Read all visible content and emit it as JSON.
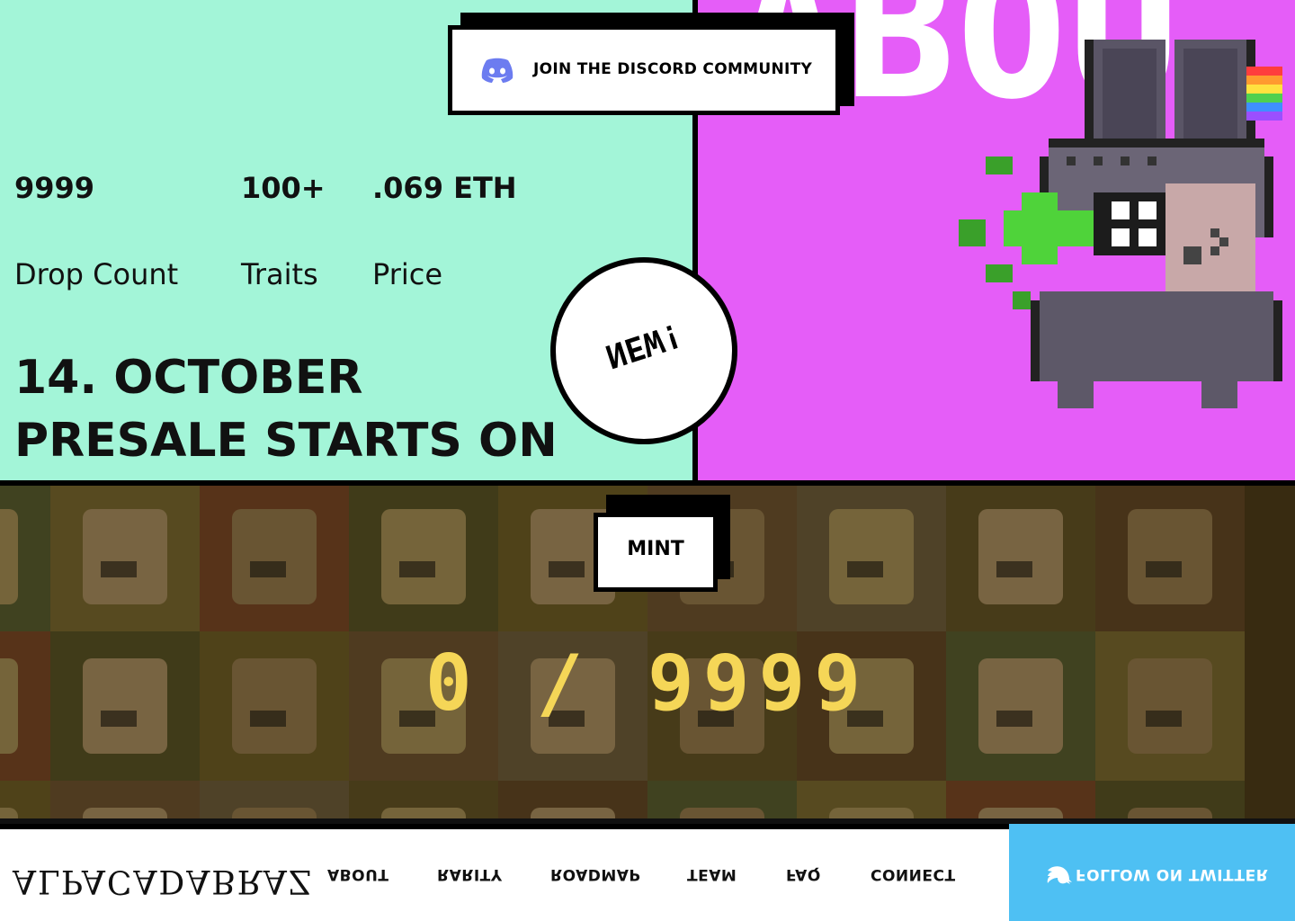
{
  "nav": {
    "logo": "ALPACADABRAZ",
    "links": [
      "ABOUT",
      "RARITY",
      "ROADMAP",
      "TEAM",
      "FAQ",
      "CONNECT"
    ],
    "twitter_label": "FOLLOW ON TWITTER"
  },
  "mint": {
    "counter": "0 / 9999",
    "button_label": "MINT"
  },
  "hero": {
    "headline_line1": "PRESALE STARTS ON",
    "headline_line2": "14. OCTOBER",
    "stats": [
      {
        "label": "Drop Count",
        "value": "9999"
      },
      {
        "label": "Traits",
        "value": "100+"
      },
      {
        "label": "Price",
        "value": ".069 ETH"
      }
    ],
    "badge": "NEW!",
    "discord_label": "JOIN THE DISCORD COMMUNITY",
    "big_word": "ABOU"
  },
  "colors": {
    "mint_green": "#a3f5d8",
    "magenta": "#e55df8",
    "twitter_blue": "#4ec0f3",
    "counter_yellow": "#f5d657"
  },
  "icons": [
    "twitter-bird-icon",
    "discord-icon"
  ]
}
